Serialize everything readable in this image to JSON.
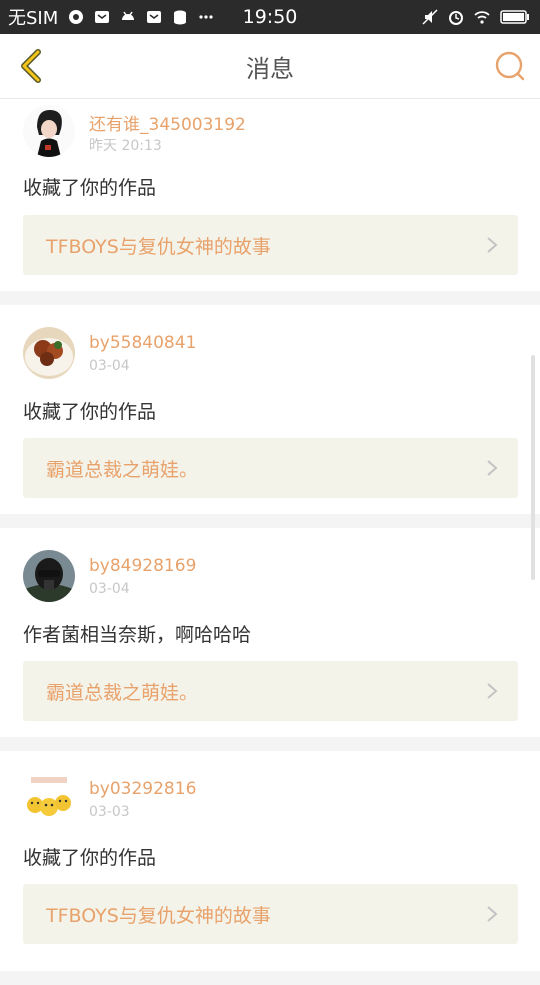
{
  "status_bar": {
    "carrier": "无SIM",
    "time": "19:50"
  },
  "nav": {
    "title": "消息",
    "back_icon": "chevron-left-icon",
    "search_icon": "search-icon"
  },
  "accent_color": "#e8a26b",
  "messages": [
    {
      "username": "还有谁_345003192",
      "time": "昨天 20:13",
      "text": "收藏了你的作品",
      "work_title": "TFBOYS与复仇女神的故事"
    },
    {
      "username": "by55840841",
      "time": "03-04",
      "text": "收藏了你的作品",
      "work_title": "霸道总裁之萌娃。"
    },
    {
      "username": "by84928169",
      "time": "03-04",
      "text": "作者菌相当奈斯，啊哈哈哈",
      "work_title": "霸道总裁之萌娃。"
    },
    {
      "username": "by03292816",
      "time": "03-03",
      "text": "收藏了你的作品",
      "work_title": "TFBOYS与复仇女神的故事"
    }
  ]
}
